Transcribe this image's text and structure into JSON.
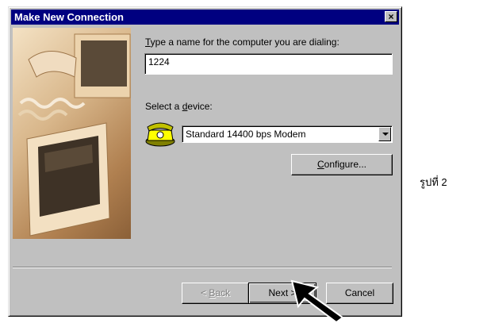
{
  "window": {
    "title": "Make New Connection",
    "close_glyph": "×"
  },
  "form": {
    "name_label_prefix": "T",
    "name_label_rest": "ype a name for the computer you are dialing:",
    "name_value": "1224",
    "device_label_prefix": "Select a ",
    "device_label_accel": "d",
    "device_label_rest": "evice:",
    "device_selected": "Standard 14400 bps Modem",
    "configure_accel": "C",
    "configure_rest": "onfigure..."
  },
  "buttons": {
    "back_prefix": "< ",
    "back_accel": "B",
    "back_rest": "ack",
    "next": "Next >",
    "cancel": "Cancel"
  },
  "caption": "รูปที่ 2",
  "icons": {
    "device": "telephone-icon",
    "pointer": "arrow-cursor-icon",
    "art": "computer-monitors-illustration"
  },
  "colors": {
    "titlebar": "#000080",
    "dialog_bg": "#c0c0c0"
  }
}
